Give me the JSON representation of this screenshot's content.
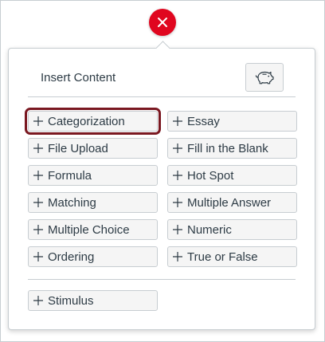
{
  "dialog": {
    "title": "Insert Content",
    "close_icon": "close-icon",
    "bank_icon": "piggy-bank-icon"
  },
  "items": [
    {
      "label": "Categorization",
      "selected": true
    },
    {
      "label": "Essay"
    },
    {
      "label": "File Upload"
    },
    {
      "label": "Fill in the Blank"
    },
    {
      "label": "Formula"
    },
    {
      "label": "Hot Spot"
    },
    {
      "label": "Matching"
    },
    {
      "label": "Multiple Answer"
    },
    {
      "label": "Multiple Choice"
    },
    {
      "label": "Numeric"
    },
    {
      "label": "Ordering"
    },
    {
      "label": "True or False"
    }
  ],
  "extra": {
    "label": "Stimulus"
  },
  "colors": {
    "close": "#e0061f",
    "selected_outline": "#7a1821",
    "button_bg": "#f5f5f5",
    "border": "#c7cdd1",
    "text": "#2d3b45"
  }
}
